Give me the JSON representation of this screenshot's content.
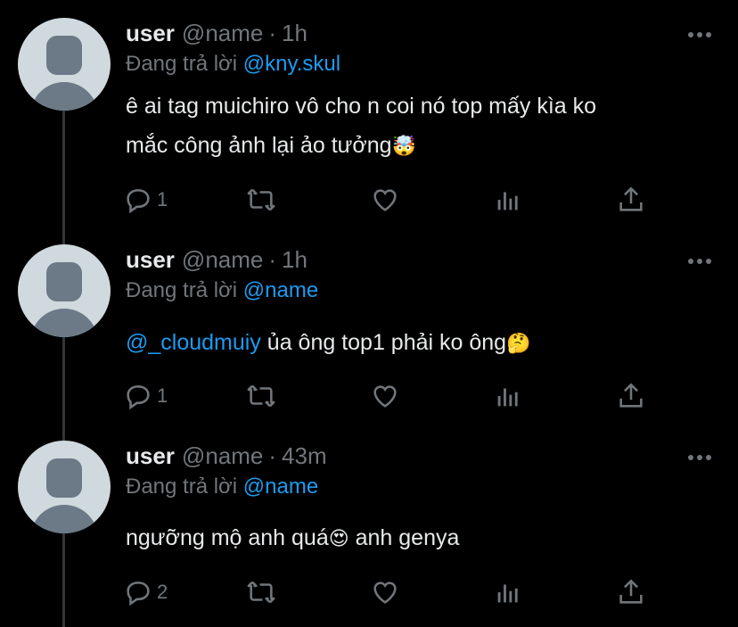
{
  "tweets": [
    {
      "username": "user",
      "handle": "@name",
      "time": "1h",
      "replying_label": "Đang trả lời",
      "replying_to": "@kny.skul",
      "text_line1": "ê ai tag muichiro vô cho n coi nó top mấy kìa ko",
      "text_line2": "mắc công ảnh lại ảo tưởng",
      "emoji": "🤯",
      "reply_count": "1"
    },
    {
      "username": "user",
      "handle": "@name",
      "time": "1h",
      "replying_label": "Đang trả lời",
      "replying_to": "@name",
      "mention": "@_cloudmuiy",
      "text_line1": " ủa ông top1 phải ko ông",
      "emoji": "🤔",
      "reply_count": "1"
    },
    {
      "username": "user",
      "handle": "@name",
      "time": "43m",
      "replying_label": "Đang trả lời",
      "replying_to": "@name",
      "text_line1": "ngưỡng mộ anh quá",
      "emoji": "😍",
      "text_line1b": " anh genya",
      "reply_count": "2"
    }
  ],
  "separator": "·",
  "icons": [
    "reply-icon",
    "retweet-icon",
    "like-icon",
    "analytics-icon",
    "share-icon",
    "more-icon"
  ],
  "colors": {
    "background": "#000000",
    "text": "#e7e9ea",
    "muted": "#71767b",
    "link": "#1d9bf0",
    "avatar_bg": "#cfd9de"
  }
}
